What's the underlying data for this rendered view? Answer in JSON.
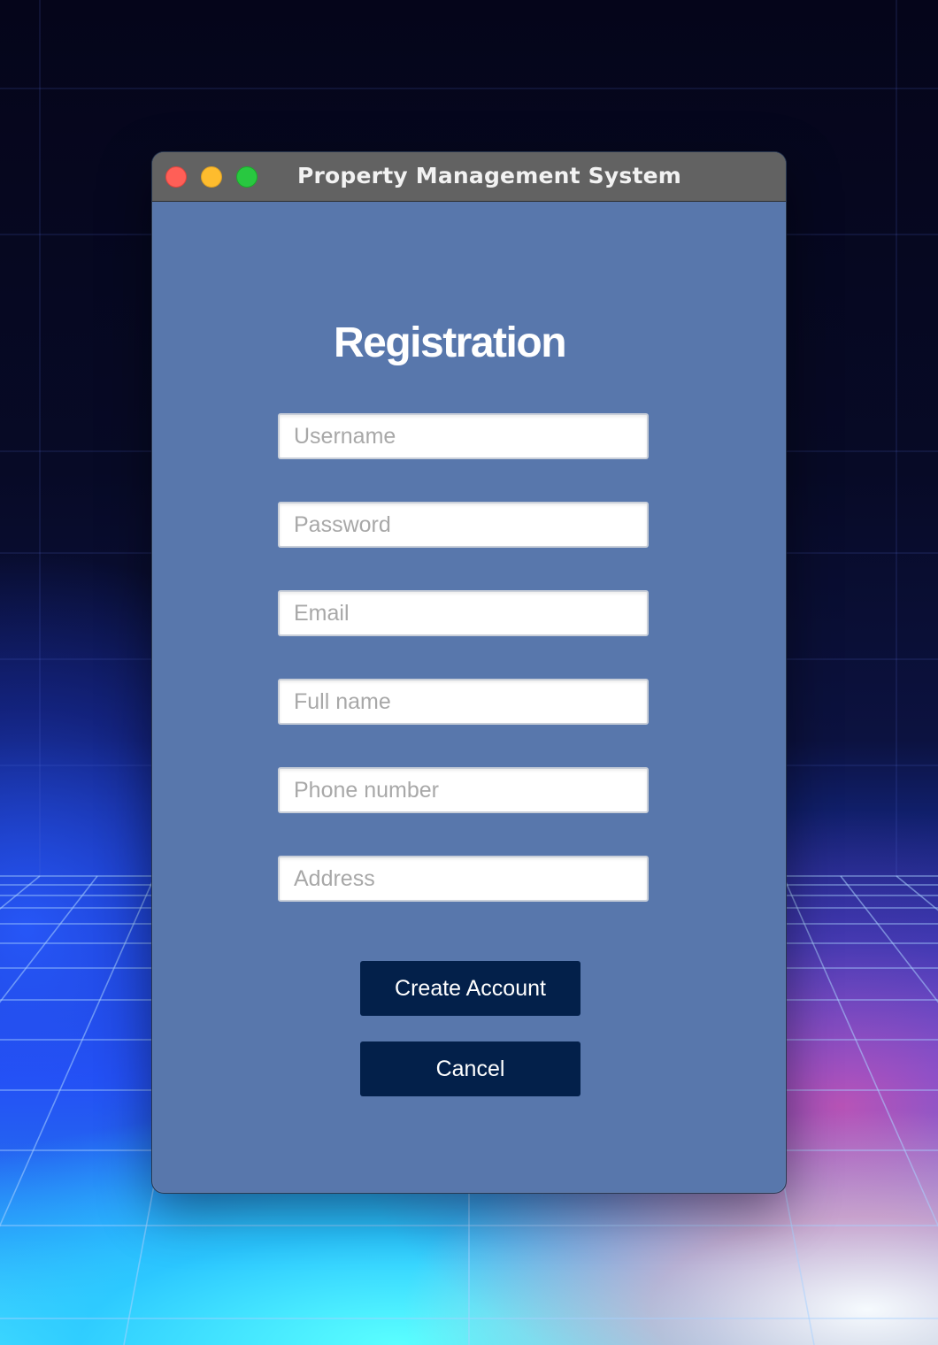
{
  "window": {
    "title": "Property Management System"
  },
  "form": {
    "heading": "Registration",
    "fields": [
      {
        "name": "username",
        "placeholder": "Username",
        "value": ""
      },
      {
        "name": "password",
        "placeholder": "Password",
        "value": ""
      },
      {
        "name": "email",
        "placeholder": "Email",
        "value": ""
      },
      {
        "name": "full_name",
        "placeholder": "Full name",
        "value": ""
      },
      {
        "name": "phone_number",
        "placeholder": "Phone number",
        "value": ""
      },
      {
        "name": "address",
        "placeholder": "Address",
        "value": ""
      }
    ],
    "create_label": "Create Account",
    "cancel_label": "Cancel"
  },
  "colors": {
    "window_bg": "#5877ac",
    "titlebar_bg": "#626262",
    "button_bg": "#03204a",
    "close": "#ff5f57",
    "minimize": "#febc2e",
    "maximize": "#28c840"
  }
}
